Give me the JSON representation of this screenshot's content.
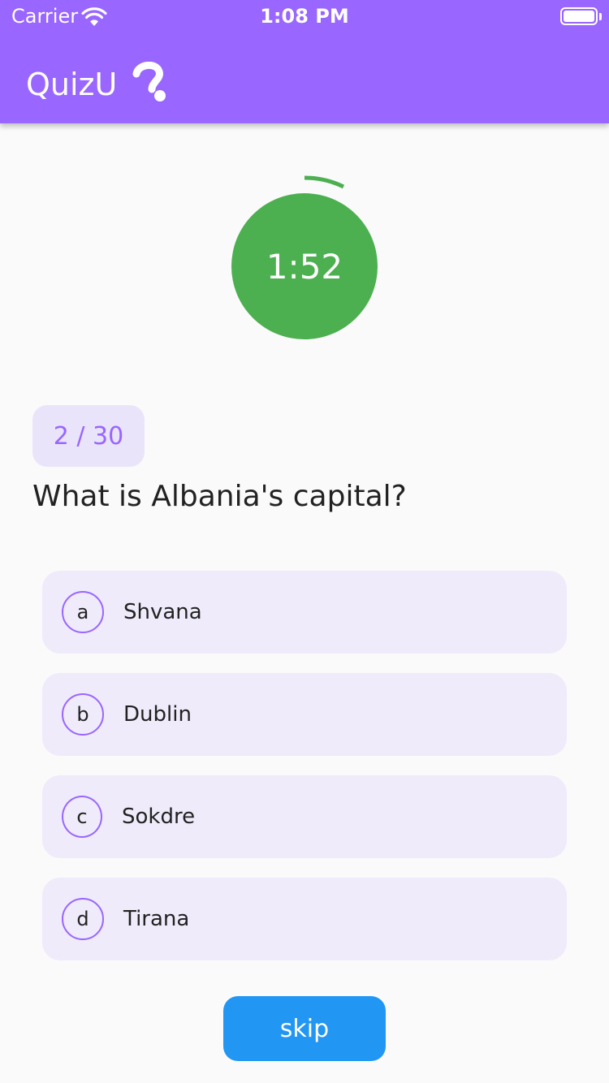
{
  "status_bar": {
    "carrier": "Carrier",
    "time": "1:08 PM"
  },
  "app_bar": {
    "title": "QuizU",
    "logo_icon": "question-mark-icon",
    "color": "#9966ff"
  },
  "timer": {
    "remaining": "1:52",
    "color": "#4caf50"
  },
  "question": {
    "counter": "2 / 30",
    "text": "What is Albania's capital?"
  },
  "options": [
    {
      "letter": "a",
      "text": "Shvana"
    },
    {
      "letter": "b",
      "text": "Dublin"
    },
    {
      "letter": "c",
      "text": "Sokdre"
    },
    {
      "letter": "d",
      "text": "Tirana"
    }
  ],
  "skip_label": "skip",
  "colors": {
    "accent": "#9966ff",
    "skip_button": "#2196f3",
    "option_background": "#efebfa"
  }
}
